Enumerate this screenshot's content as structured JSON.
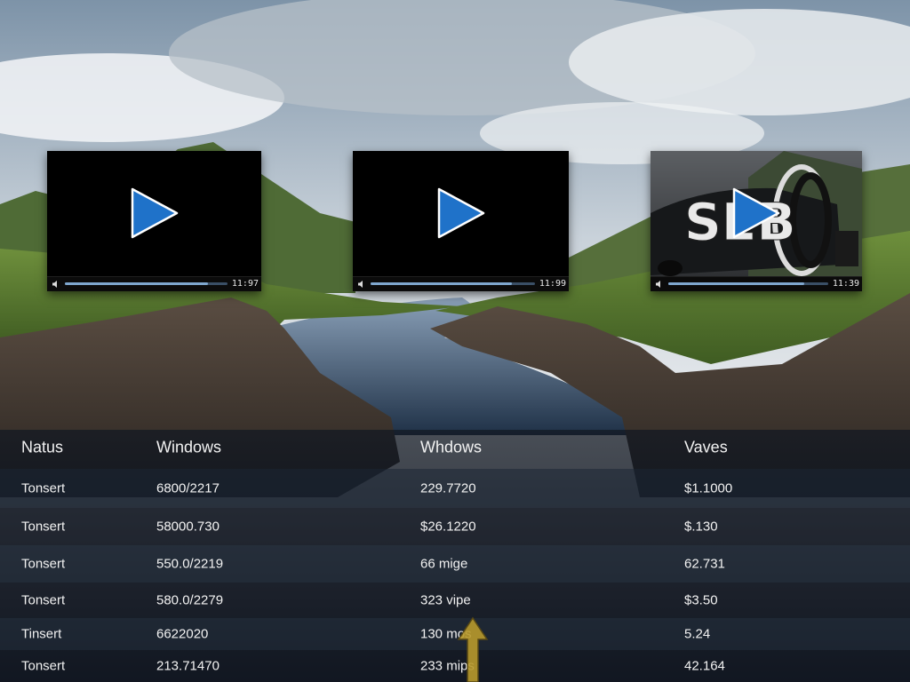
{
  "videos": [
    {
      "time": "11:97",
      "progress": 0.88
    },
    {
      "time": "11:99",
      "progress": 0.86
    },
    {
      "time": "11:39",
      "progress": 0.85,
      "thumbnail_text": "SEB"
    }
  ],
  "table": {
    "headers": [
      "Natus",
      "Windows",
      "Whdows",
      "Vaves"
    ],
    "rows": [
      [
        "Tonsert",
        "6800/2217",
        "229.7720",
        "$1.1000"
      ],
      [
        "Tonsert",
        "58000.730",
        "$26.1220",
        "$.130"
      ],
      [
        "Tonsert",
        "550.0/2219",
        "66 mige",
        "62.731"
      ],
      [
        "Tonsert",
        "580.0/2279",
        "323 vipe",
        "$3.50"
      ],
      [
        "Tinsert",
        "6622020",
        "130 mos",
        "5.24"
      ],
      [
        "Tonsert",
        "213.71470",
        "233 mips",
        "42.164"
      ]
    ]
  },
  "colors": {
    "play_button": "#1f72c9",
    "progress_fill": "#7fa7cf",
    "table_text": "#f2f2f2"
  },
  "icons": [
    "play-icon",
    "volume-icon",
    "cursor-arrow-icon"
  ]
}
